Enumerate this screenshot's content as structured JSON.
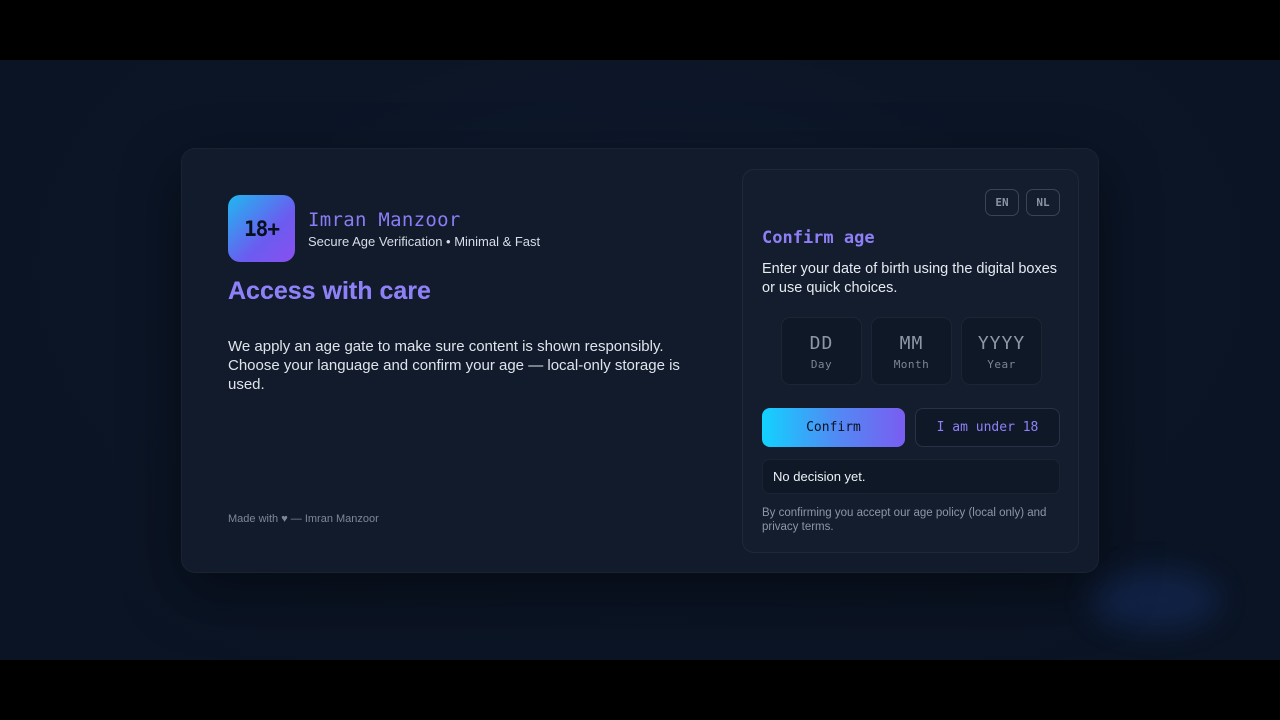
{
  "brand": {
    "badge": "18+",
    "name": "Imran Manzoor",
    "tagline": "Secure Age Verification • Minimal & Fast"
  },
  "hero": {
    "headline": "Access with care",
    "intro": "We apply an age gate to make sure content is shown responsibly. Choose your language and confirm your age — local-only storage is used."
  },
  "footer": {
    "credit": "Made with ♥ — Imran Manzoor"
  },
  "panel": {
    "languages": [
      "EN",
      "NL"
    ],
    "title": "Confirm age",
    "description": "Enter your date of birth using the digital boxes or use quick choices.",
    "dob": {
      "day": {
        "placeholder": "DD",
        "label": "Day"
      },
      "month": {
        "placeholder": "MM",
        "label": "Month"
      },
      "year": {
        "placeholder": "YYYY",
        "label": "Year"
      }
    },
    "confirm_label": "Confirm",
    "under_label": "I am under 18",
    "status": "No decision yet.",
    "policy": "By confirming you accept our age policy (local only) and privacy terms."
  },
  "colors": {
    "accent_purple": "#8b7cf6",
    "accent_cyan": "#12d2ff",
    "background": "#0b1526",
    "card": "#111b2b"
  }
}
